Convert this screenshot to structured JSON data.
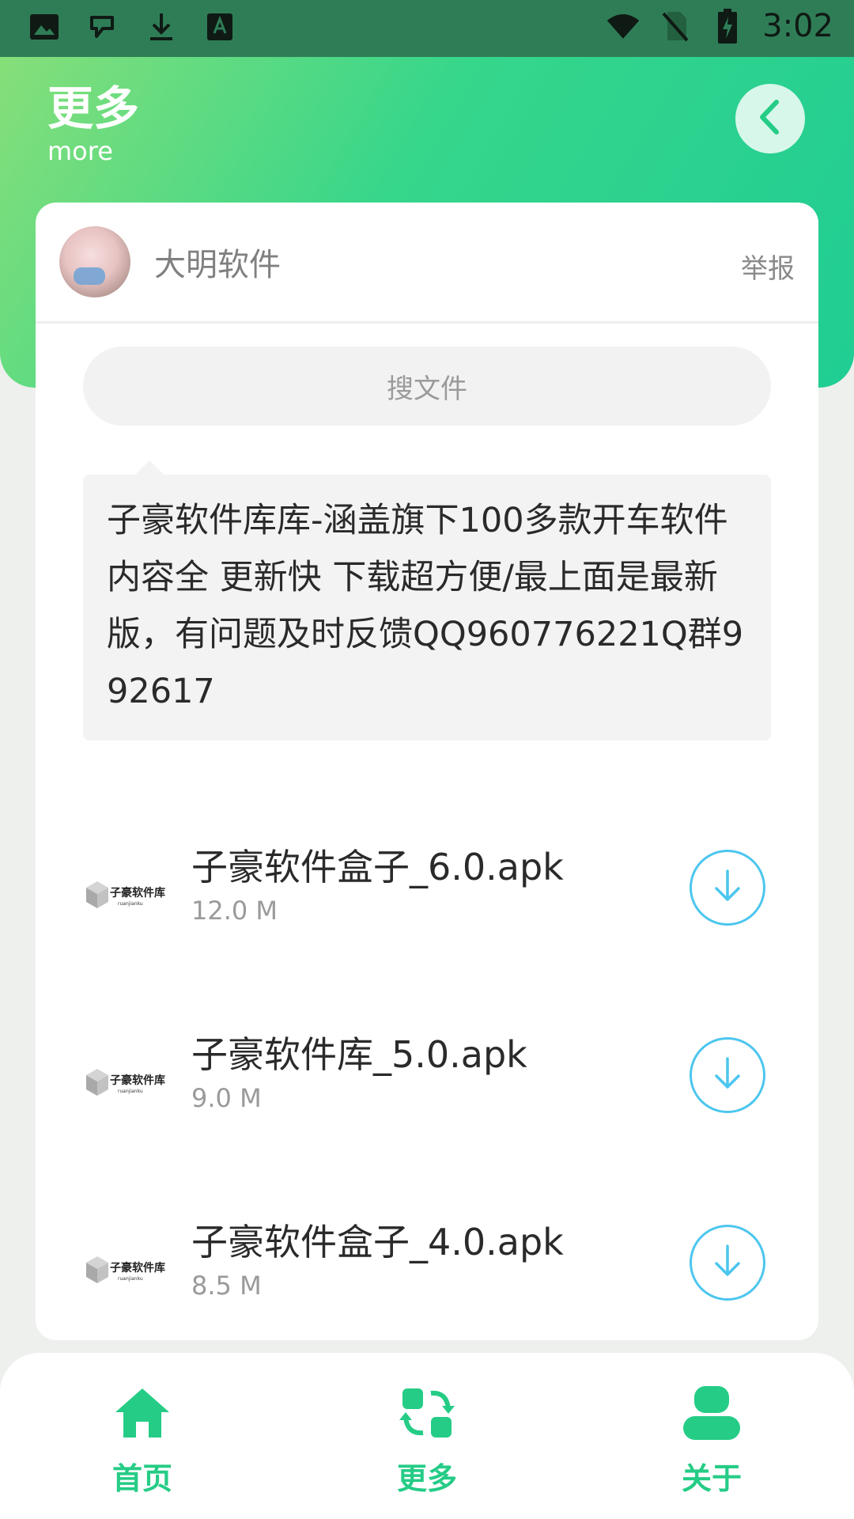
{
  "status_bar": {
    "time": "3:02",
    "icons_left": [
      "image-icon",
      "chat-app-icon",
      "download-icon",
      "text-a-icon"
    ],
    "icons_right": [
      "wifi-icon",
      "no-sim-icon",
      "battery-charging-icon"
    ]
  },
  "header": {
    "title": "更多",
    "subtitle": "more",
    "back_icon": "chevron-left-icon"
  },
  "owner": {
    "name": "大明软件",
    "report_label": "举报"
  },
  "search": {
    "placeholder": "搜文件"
  },
  "notice": {
    "text": "子豪软件库库-涵盖旗下100多款开车软件 内容全 更新快 下载超方便/最上面是最新版，有问题及时反馈QQ960776221Q群992617"
  },
  "files": [
    {
      "name": "子豪软件盒子_6.0.apk",
      "size": "12.0 M",
      "logo_text": "子豪软件库",
      "logo_sub": "ruanjianku"
    },
    {
      "name": "子豪软件库_5.0.apk",
      "size": "9.0 M",
      "logo_text": "子豪软件库",
      "logo_sub": "ruanjianku"
    },
    {
      "name": "子豪软件盒子_4.0.apk",
      "size": "8.5 M",
      "logo_text": "子豪软件库",
      "logo_sub": "ruanjianku"
    }
  ],
  "bottom_nav": {
    "items": [
      {
        "label": "首页",
        "icon": "home-icon"
      },
      {
        "label": "更多",
        "icon": "swap-icon"
      },
      {
        "label": "关于",
        "icon": "user-icon"
      }
    ]
  },
  "colors": {
    "accent": "#25cc86",
    "download": "#4cc6ee",
    "header_gradient_start": "#86df79",
    "header_gradient_end": "#20cd93"
  }
}
